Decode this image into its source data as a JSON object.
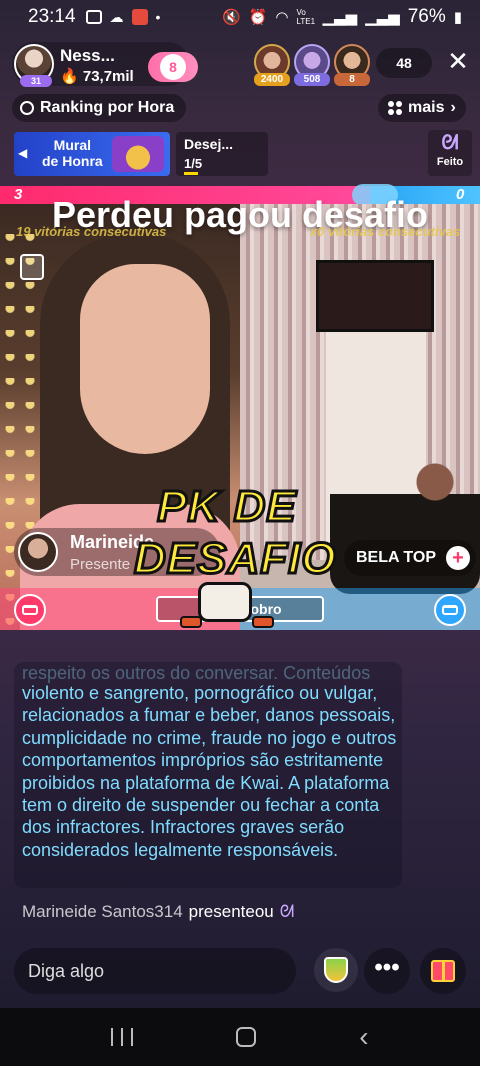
{
  "status_bar": {
    "time": "23:14",
    "battery": "76%",
    "network": "Vo LTE1"
  },
  "host": {
    "name": "Ness...",
    "followers": "73,7mil",
    "level": "31",
    "fan_badge": "8"
  },
  "viewers": [
    {
      "tag": "2400"
    },
    {
      "tag": "508"
    },
    {
      "tag": "8"
    }
  ],
  "viewer_count": "48",
  "ranking": "Ranking por Hora",
  "mais": "mais",
  "mural": {
    "line1": "Mural",
    "line2": "de Honra"
  },
  "desej": {
    "title": "Desej...",
    "count": "1/5"
  },
  "feito": "Feito",
  "pk": {
    "score_left": "3",
    "score_right": "0",
    "title": "Perdeu pagou desafio",
    "streak_left": "19 vitórias consecutivas",
    "streak_right": "x0 vitórias consecutivas",
    "opponent_name": "Marineide",
    "opponent_sub": "Presente",
    "right_name": "BELA TOP",
    "double_label": "Ponto dobro",
    "sticker_line1": "PK DE",
    "sticker_line2": "DESAFIO",
    "colors": {
      "left": "#ff2a6d",
      "right": "#27a4f5"
    }
  },
  "notice": {
    "faded": "respeito os outros do conversar. Conteúdos",
    "body": "violento e sangrento, pornográfico ou vulgar, relacionados a fumar e beber, danos pessoais, cumplicidade no crime, fraude no jogo e outros comportamentos impróprios são estritamente proibidos na plataforma de Kwai. A plataforma tem o direito de suspender ou fechar a conta dos infractores. Infractores graves serão considerados legalmente responsáveis."
  },
  "gift_event": {
    "who": "Marineide Santos314",
    "action": "presenteou"
  },
  "input_placeholder": "Diga algo",
  "icons": [
    "clock-icon",
    "grid-icon",
    "close-icon",
    "bunny-icon",
    "sofa-icon",
    "cup-icon",
    "more-icon",
    "gift-icon"
  ]
}
